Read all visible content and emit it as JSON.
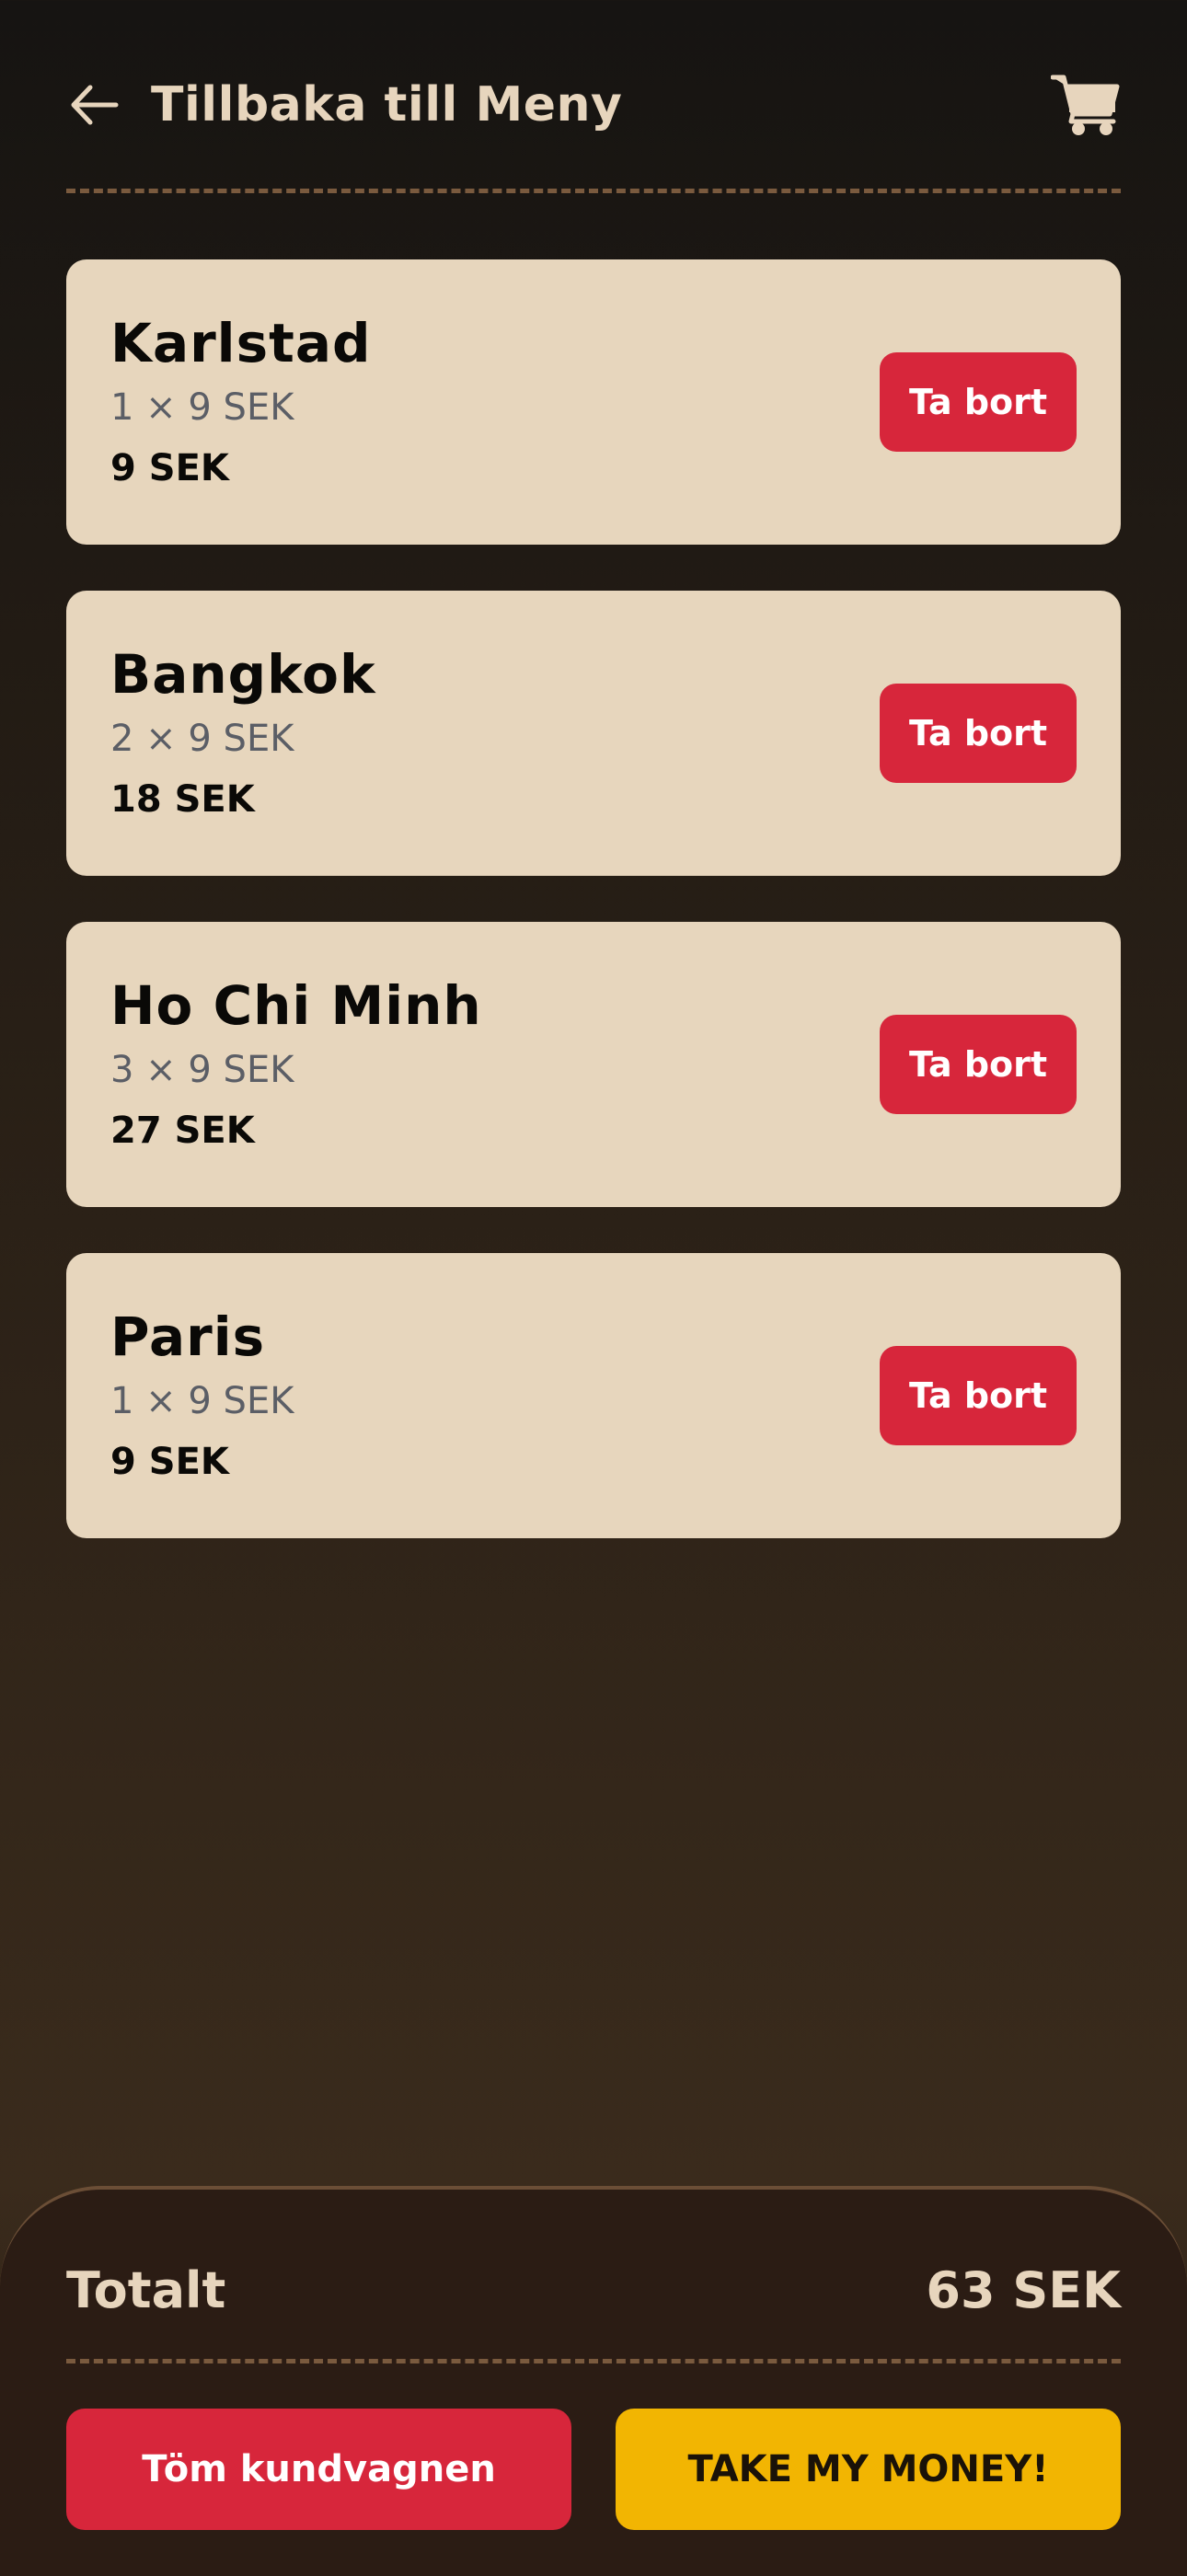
{
  "header": {
    "back_label": "Tillbaka till Meny",
    "back_icon": "arrow-left-icon",
    "cart_icon": "shopping-cart-icon"
  },
  "cart": {
    "items": [
      {
        "name": "Karlstad",
        "qty_line": "1 × 9 SEK",
        "total": "9 SEK",
        "remove_label": "Ta bort"
      },
      {
        "name": "Bangkok",
        "qty_line": "2 × 9 SEK",
        "total": "18 SEK",
        "remove_label": "Ta bort"
      },
      {
        "name": "Ho Chi Minh",
        "qty_line": "3 × 9 SEK",
        "total": "27 SEK",
        "remove_label": "Ta bort"
      },
      {
        "name": "Paris",
        "qty_line": "1 × 9 SEK",
        "total": "9 SEK",
        "remove_label": "Ta bort"
      }
    ]
  },
  "summary": {
    "total_label": "Totalt",
    "total_value": "63 SEK",
    "clear_label": "Töm kundvagnen",
    "pay_label": "TAKE MY MONEY!"
  },
  "colors": {
    "accent_red": "#d7263b",
    "accent_yellow": "#f2b502",
    "card_bg": "#e7d6bd",
    "header_text": "#e7d5bd"
  }
}
